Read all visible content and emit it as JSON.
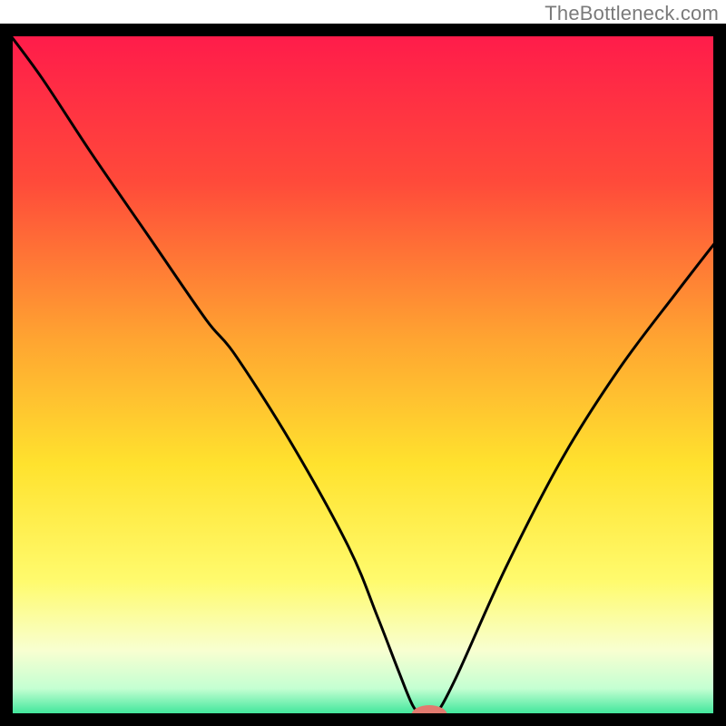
{
  "watermark": "TheBottleneck.com",
  "chart_data": {
    "type": "line",
    "title": "",
    "xlabel": "",
    "ylabel": "",
    "xlim": [
      0,
      100
    ],
    "ylim": [
      0,
      100
    ],
    "grid": false,
    "legend": false,
    "background_gradient": {
      "stops": [
        {
          "offset": 0.0,
          "color": "#ff1a4b"
        },
        {
          "offset": 0.22,
          "color": "#ff4a3a"
        },
        {
          "offset": 0.45,
          "color": "#ffa531"
        },
        {
          "offset": 0.63,
          "color": "#ffe22e"
        },
        {
          "offset": 0.8,
          "color": "#fffb6e"
        },
        {
          "offset": 0.9,
          "color": "#f8ffd1"
        },
        {
          "offset": 0.955,
          "color": "#c4ffd2"
        },
        {
          "offset": 1.0,
          "color": "#21e08e"
        }
      ]
    },
    "series": [
      {
        "name": "bottleneck-curve",
        "x": [
          0,
          5,
          12,
          20,
          28,
          32,
          40,
          48,
          52,
          55,
          57,
          58.5,
          60,
          63,
          70,
          78,
          86,
          94,
          100
        ],
        "values": [
          100,
          93,
          82,
          70,
          58,
          53,
          40,
          25,
          15,
          7,
          2,
          0.5,
          0.5,
          6,
          22,
          38,
          51,
          62,
          70
        ]
      }
    ],
    "marker": {
      "name": "optimal-point",
      "x": 59.3,
      "y": 0.7,
      "rx": 2.5,
      "ry": 1.4,
      "color": "#e27a6f"
    }
  }
}
